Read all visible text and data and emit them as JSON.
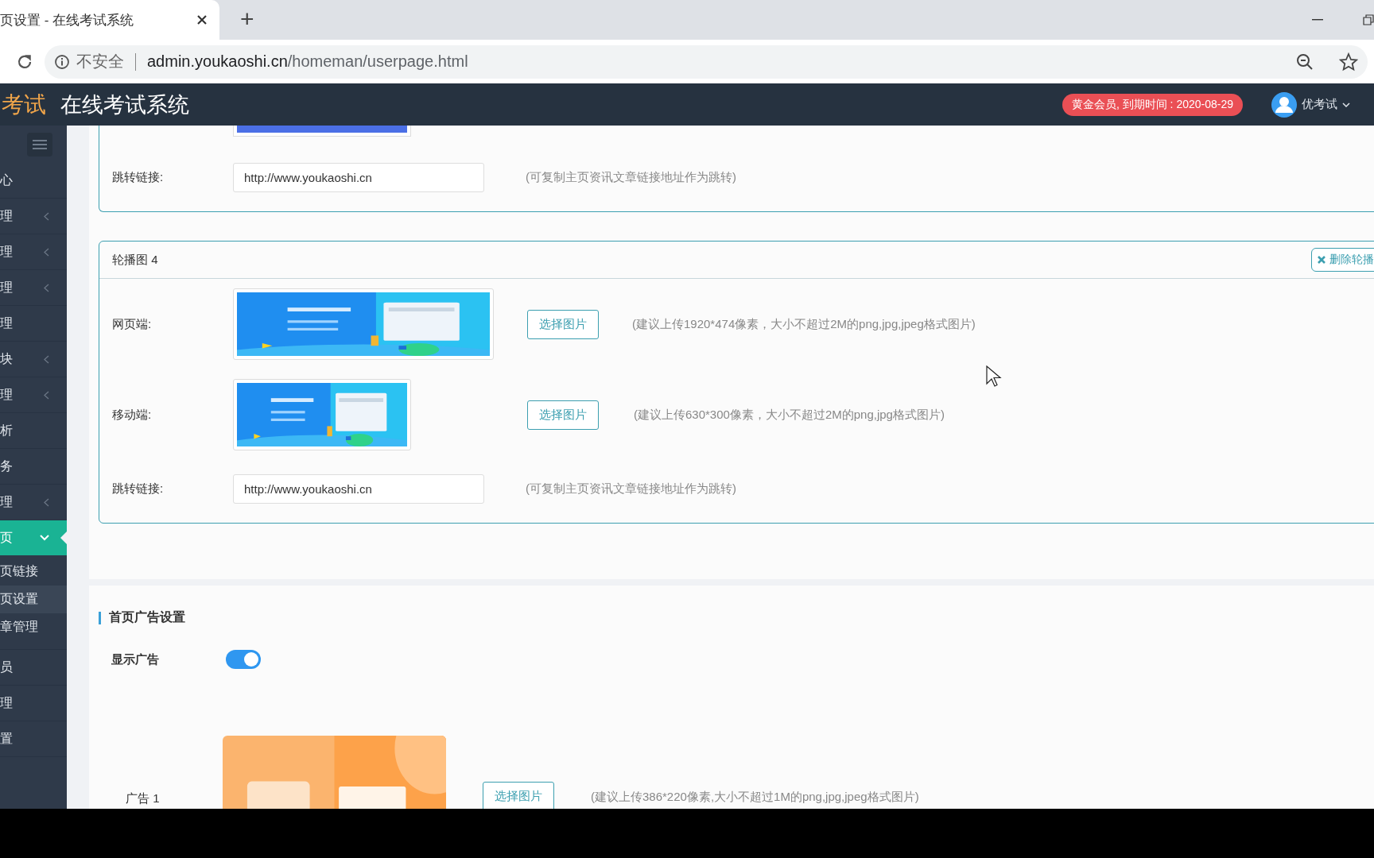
{
  "browser": {
    "tab_title": "页设置 - 在线考试系统",
    "new_tab": "+",
    "security": "不安全",
    "url_host": "admin.youkaoshi.cn",
    "url_path": "/homeman/userpage.html"
  },
  "header": {
    "logo": "考试",
    "title": "在线考试系统",
    "membership": "黄金会员, 到期时间 : 2020-08-29",
    "user": "优考试"
  },
  "sidebar": {
    "items": [
      {
        "label": "心",
        "has_arrow": false,
        "expanded": false
      },
      {
        "label": "理",
        "has_arrow": true,
        "expanded": false
      },
      {
        "label": "理",
        "has_arrow": true,
        "expanded": false
      },
      {
        "label": "理",
        "has_arrow": true,
        "expanded": false
      },
      {
        "label": "理",
        "has_arrow": false,
        "expanded": false
      },
      {
        "label": "块",
        "has_arrow": true,
        "expanded": false
      },
      {
        "label": "理",
        "has_arrow": true,
        "expanded": false
      },
      {
        "label": "析",
        "has_arrow": false,
        "expanded": false
      },
      {
        "label": "务",
        "has_arrow": false,
        "expanded": false
      },
      {
        "label": "理",
        "has_arrow": true,
        "expanded": false
      },
      {
        "label": "页",
        "has_arrow": true,
        "expanded": true,
        "children": [
          {
            "label": "页链接",
            "selected": false
          },
          {
            "label": "页设置",
            "selected": true
          },
          {
            "label": "章管理",
            "selected": false
          }
        ]
      },
      {
        "label": "员",
        "has_arrow": false,
        "expanded": false
      },
      {
        "label": "理",
        "has_arrow": false,
        "expanded": false
      },
      {
        "label": "置",
        "has_arrow": false,
        "expanded": false
      }
    ]
  },
  "carousel_cards": [
    {
      "rows": [
        {
          "kind": "link",
          "label": "跳转链接:",
          "value": "http://www.youkaoshi.cn",
          "hint": "(可复制主页资讯文章链接地址作为跳转)"
        }
      ]
    },
    {
      "title": "轮播图 4",
      "delete_button": "删除轮播",
      "rows": [
        {
          "kind": "desktop_image",
          "label": "网页端:",
          "button": "选择图片",
          "hint": "(建议上传1920*474像素，大小不超过2M的png,jpg,jpeg格式图片)"
        },
        {
          "kind": "mobile_image",
          "label": "移动端:",
          "button": "选择图片",
          "hint": "(建议上传630*300像素，大小不超过2M的png,jpg格式图片)"
        },
        {
          "kind": "link",
          "label": "跳转链接:",
          "value": "http://www.youkaoshi.cn",
          "hint": "(可复制主页资讯文章链接地址作为跳转)"
        }
      ]
    }
  ],
  "ad_section": {
    "title": "首页广告设置",
    "show_ad": {
      "label": "显示广告",
      "on": true
    },
    "ads": [
      {
        "label": "广告 1",
        "button": "选择图片",
        "hint": "(建议上传386*220像素,大小不超过1M的png,jpg,jpeg格式图片)"
      }
    ]
  }
}
